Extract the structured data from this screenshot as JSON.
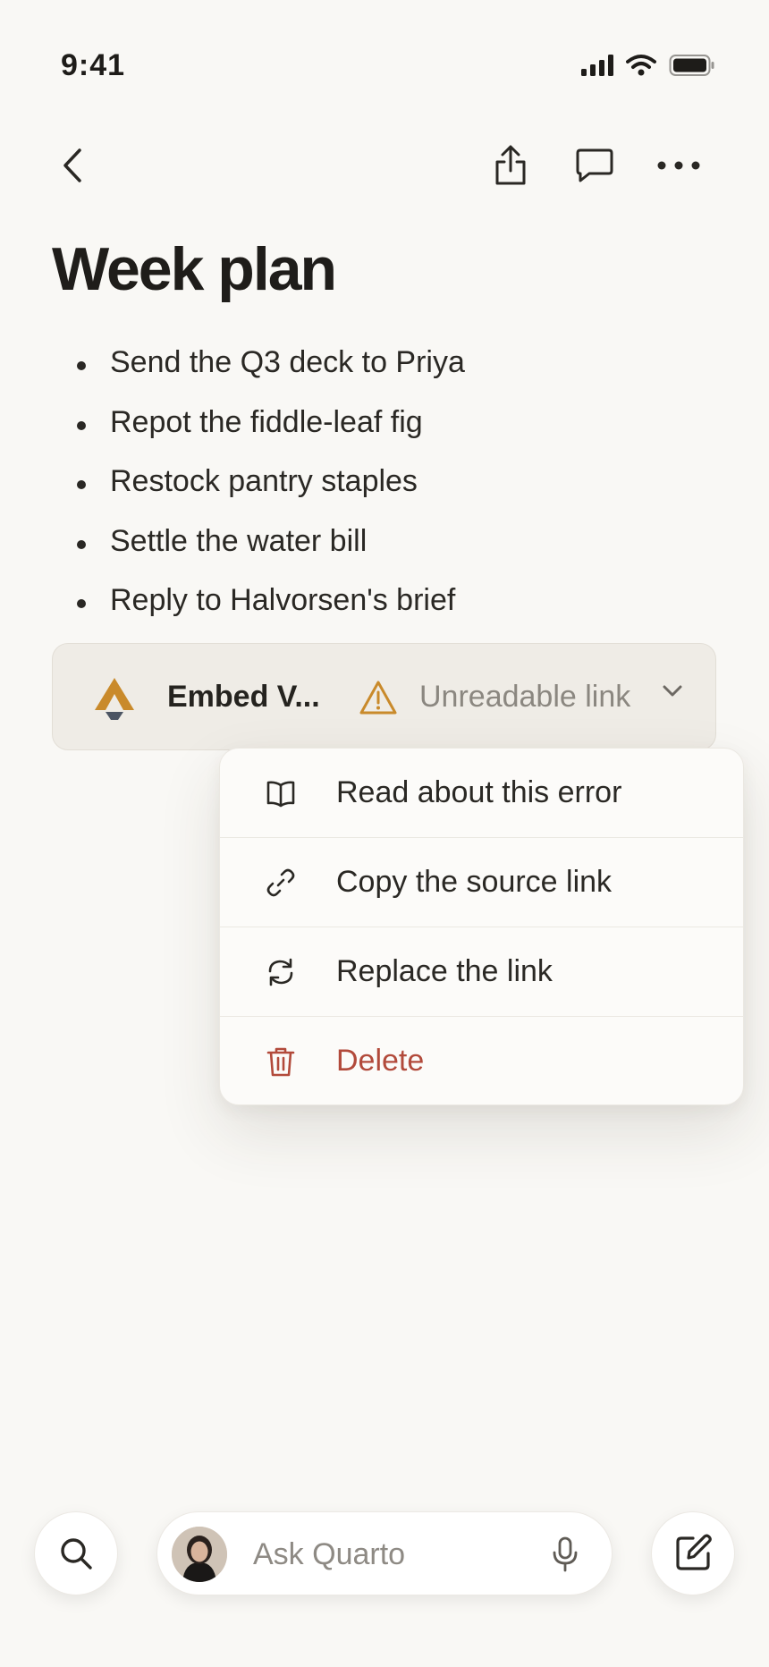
{
  "status_bar": {
    "time": "9:41"
  },
  "nav": {
    "back_icon": "chevron-left-icon",
    "share_icon": "share-icon",
    "comment_icon": "comment-icon",
    "more_icon": "more-horizontal-icon"
  },
  "page": {
    "title": "Week plan",
    "bullets": [
      "Send the Q3 deck to Priya",
      "Repot the fiddle-leaf fig",
      "Restock pantry staples",
      "Settle the water bill",
      "Reply to Halvorsen's brief"
    ]
  },
  "embed": {
    "title": "Embed V...",
    "status": "Unreadable link",
    "warning_color": "#c98a2b"
  },
  "menu": {
    "items": [
      {
        "label": "Read about this error",
        "icon": "book-icon"
      },
      {
        "label": "Copy the source link",
        "icon": "link-icon"
      },
      {
        "label": "Replace the link",
        "icon": "refresh-icon"
      },
      {
        "label": "Delete",
        "icon": "trash-icon",
        "color": "#b24a3b"
      }
    ]
  },
  "bottom_bar": {
    "ask_placeholder": "Ask Quarto",
    "search_icon": "search-icon",
    "mic_icon": "mic-icon",
    "compose_icon": "compose-icon"
  }
}
